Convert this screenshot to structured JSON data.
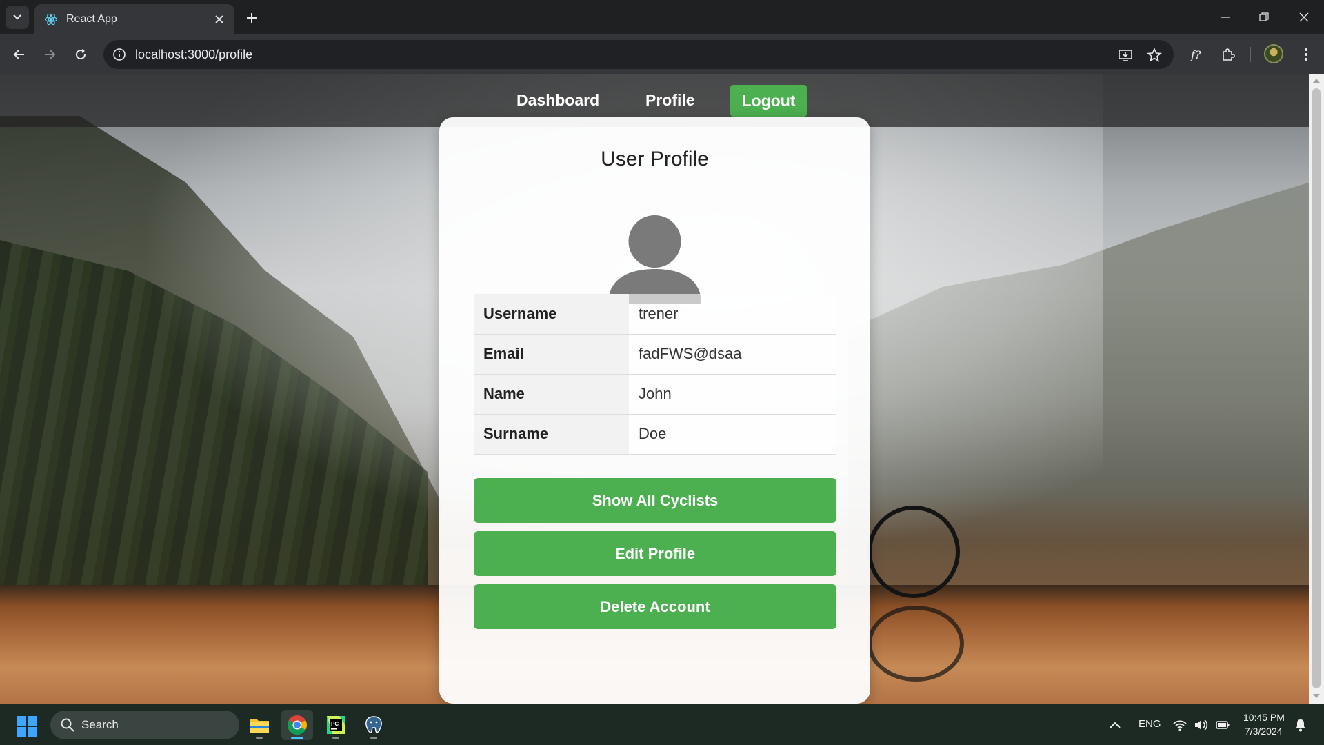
{
  "browser": {
    "tab_title": "React App",
    "url": "localhost:3000/profile"
  },
  "navbar": {
    "dashboard": "Dashboard",
    "profile": "Profile",
    "logout": "Logout"
  },
  "profile": {
    "heading": "User Profile",
    "fields": [
      {
        "label": "Username",
        "value": "trener"
      },
      {
        "label": "Email",
        "value": "fadFWS@dsaa"
      },
      {
        "label": "Name",
        "value": "John"
      },
      {
        "label": "Surname",
        "value": "Doe"
      }
    ],
    "buttons": {
      "show_all": "Show All Cyclists",
      "edit": "Edit Profile",
      "delete": "Delete Account"
    }
  },
  "taskbar": {
    "search_label": "Search",
    "language": "ENG",
    "time": "10:45 PM",
    "date": "7/3/2024",
    "apps": [
      "file-explorer-icon",
      "chrome-icon",
      "pycharm-icon",
      "pgadmin-icon"
    ]
  },
  "colors": {
    "accent_green": "#4caf50",
    "browser_dark": "#35363a"
  }
}
